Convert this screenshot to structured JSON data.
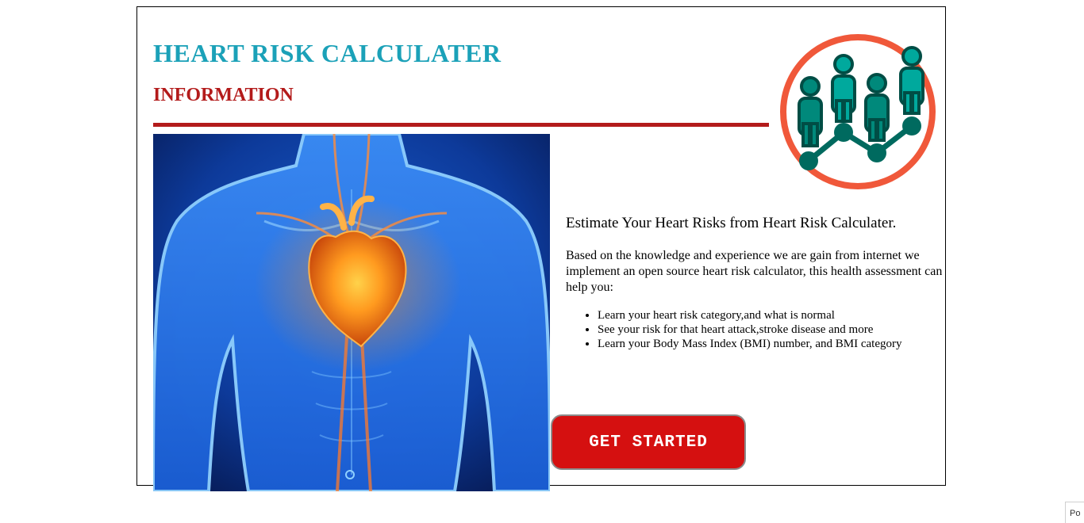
{
  "header": {
    "title": "HEART RISK CALCULATER",
    "subtitle": "INFORMATION"
  },
  "logo": {
    "icon": "people-chart-logo-icon"
  },
  "hero_image": {
    "icon": "human-torso-heart-illustration"
  },
  "info": {
    "title": "Estimate Your Heart Risks from Heart Risk Calculater.",
    "body": "Based on the knowledge and experience we are gain from internet we implement an open source heart risk calculator, this health assessment can help you:",
    "bullets": [
      "Learn your heart risk category,and what is normal",
      "See your risk for that heart attack,stroke disease and more",
      "Learn your Body Mass Index (BMI) number, and BMI category"
    ]
  },
  "cta": {
    "label": "GET STARTED"
  },
  "corner_tab": {
    "label": "Po"
  },
  "colors": {
    "title": "#1ba1b8",
    "subtitle": "#b31b1b",
    "rule": "#b31b1b",
    "button": "#d51010",
    "logo_ring": "#f0583a",
    "logo_people": "#00a99d",
    "logo_dark": "#006a5f"
  }
}
